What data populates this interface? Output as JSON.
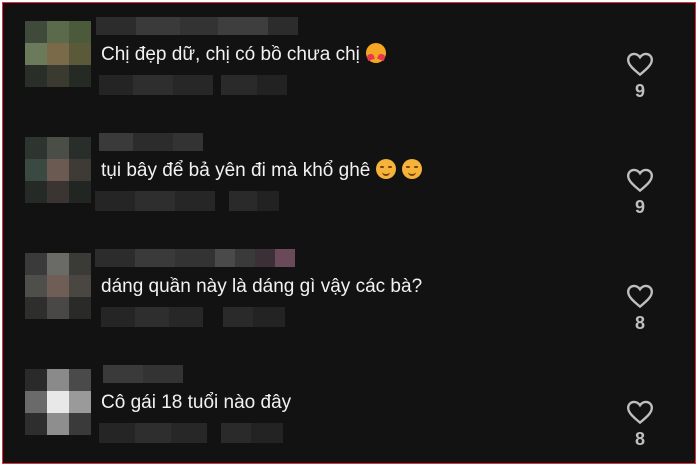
{
  "comments": [
    {
      "text": "Chị đẹp dữ, chị có bồ chưa chị",
      "emoji": [
        "smiling-face-with-hearts"
      ],
      "likes": "9"
    },
    {
      "text": "tụi bây để bả yên đi mà khổ ghê",
      "emoji": [
        "relieved-face",
        "relieved-face"
      ],
      "likes": "9"
    },
    {
      "text": "dáng quần này là dáng gì vậy các bà?",
      "emoji": [],
      "likes": "8"
    },
    {
      "text": "Cô gái 18 tuổi nào đây",
      "emoji": [],
      "likes": "8"
    }
  ],
  "icons": {
    "like": "heart-outline-icon"
  },
  "colors": {
    "background": "#121212",
    "text": "#f2f2f2",
    "count": "#bfbfbf",
    "frame": "#e0323c"
  }
}
